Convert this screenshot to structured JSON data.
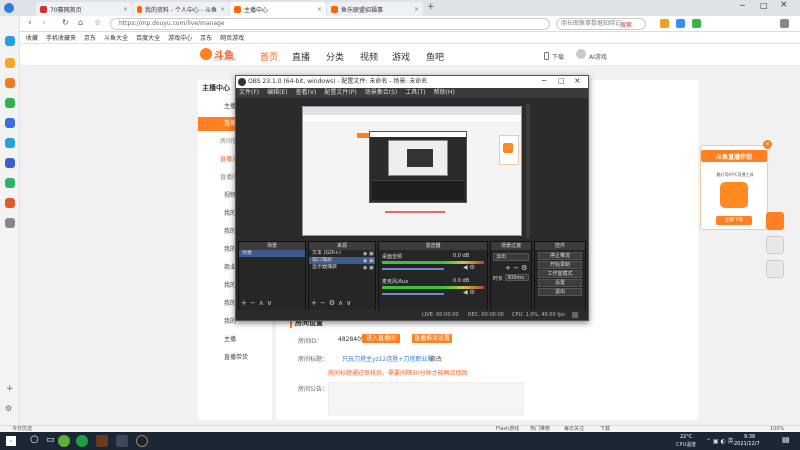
{
  "browser": {
    "tabs": [
      {
        "label": "70赛网首页",
        "active": false
      },
      {
        "label": "我的资料 - 个人中心 - 斗鱼",
        "active": false
      },
      {
        "label": "主播中心",
        "active": true
      },
      {
        "label": "鱼乐联盟招福事",
        "active": false
      }
    ],
    "url": "https://mp.douyu.com/live/manage",
    "search_placeholder": "朋长图像事数据知晓记",
    "search_button": "搜索",
    "bookmarks": [
      "收藏",
      "手机收藏夹",
      "京东",
      "斗鱼大全",
      "百度大全",
      "游戏中心",
      "京东",
      "网页游戏"
    ]
  },
  "douyu": {
    "logo": "斗鱼",
    "logo_sub": "DOUYU.COM",
    "nav": [
      {
        "label": "首页"
      },
      {
        "label": "直播"
      },
      {
        "label": "分类"
      },
      {
        "label": "视频"
      },
      {
        "label": "游戏"
      },
      {
        "label": "鱼吧"
      }
    ],
    "header_right": {
      "download": "下载",
      "user": "AI游戏"
    },
    "side_title": "主播中心",
    "side_items": [
      "主播",
      "直播",
      "房间管理",
      "直播设置",
      "直播间",
      "视频",
      "我的",
      "我的",
      "我的",
      "商业",
      "我的",
      "我的",
      "我的",
      "主播",
      "直播带货"
    ],
    "room": {
      "section": "房间设置",
      "room_id_label": "房间ID：",
      "room_id": "4828405",
      "enter_btn": "进入直播间",
      "settings_btn": "直播推流设置",
      "title_label": "房间标题：",
      "title_value": "只玩刀塔主yz12连胜+刀塔职业服",
      "edit": "修改",
      "tip": "房间标题通过审核后，需要间隔30分钟才能再次修改",
      "notice_label": "房间公告："
    },
    "promo": {
      "title": "斗鱼直播伴侣",
      "desc": "最好用的PC直播工具",
      "button": "立即下载"
    }
  },
  "obs": {
    "title": "OBS 23.1.0 (64-bit, windows) - 配置文件: 未命名 - 场景: 未命名",
    "menu": [
      "文件(F)",
      "编辑(E)",
      "查看(V)",
      "配置文件(P)",
      "场景集合(S)",
      "工具(T)",
      "帮助(H)"
    ],
    "docks": {
      "scenes": {
        "title": "场景",
        "items": [
          "场景"
        ]
      },
      "sources": {
        "title": "来源",
        "items": [
          "文本 (GDI+)",
          "窗口捕获",
          "显示器捕获"
        ]
      },
      "mixer": {
        "title": "混音器",
        "channels": [
          {
            "name": "桌面音频",
            "db": "0.0 dB"
          },
          {
            "name": "麦克风/Aux",
            "db": "0.0 dB"
          }
        ]
      },
      "transitions": {
        "title": "场景过渡",
        "type": "淡出",
        "duration_label": "时长",
        "duration": "300ms"
      },
      "controls": {
        "title": "控件",
        "buttons": [
          "停止推流",
          "开始录制",
          "工作室模式",
          "设置",
          "退出"
        ]
      }
    },
    "status": {
      "live": "LIVE: 00:00:00",
      "rec": "REC: 00:00:00",
      "cpu": "CPU: 1.0%, 40.00 fps"
    }
  },
  "statusbar": {
    "left": "今日优选",
    "items": [
      "Flash游戏",
      "热门推荐",
      "每日关注",
      "下载",
      "100%"
    ]
  },
  "taskbar": {
    "weather": "22°C",
    "weather_sub": "CPU温度",
    "time": "9:38",
    "date": "2021/12/7"
  },
  "colors": {
    "accent": "#ff5d23",
    "side_highlight": "#ff7f22"
  }
}
